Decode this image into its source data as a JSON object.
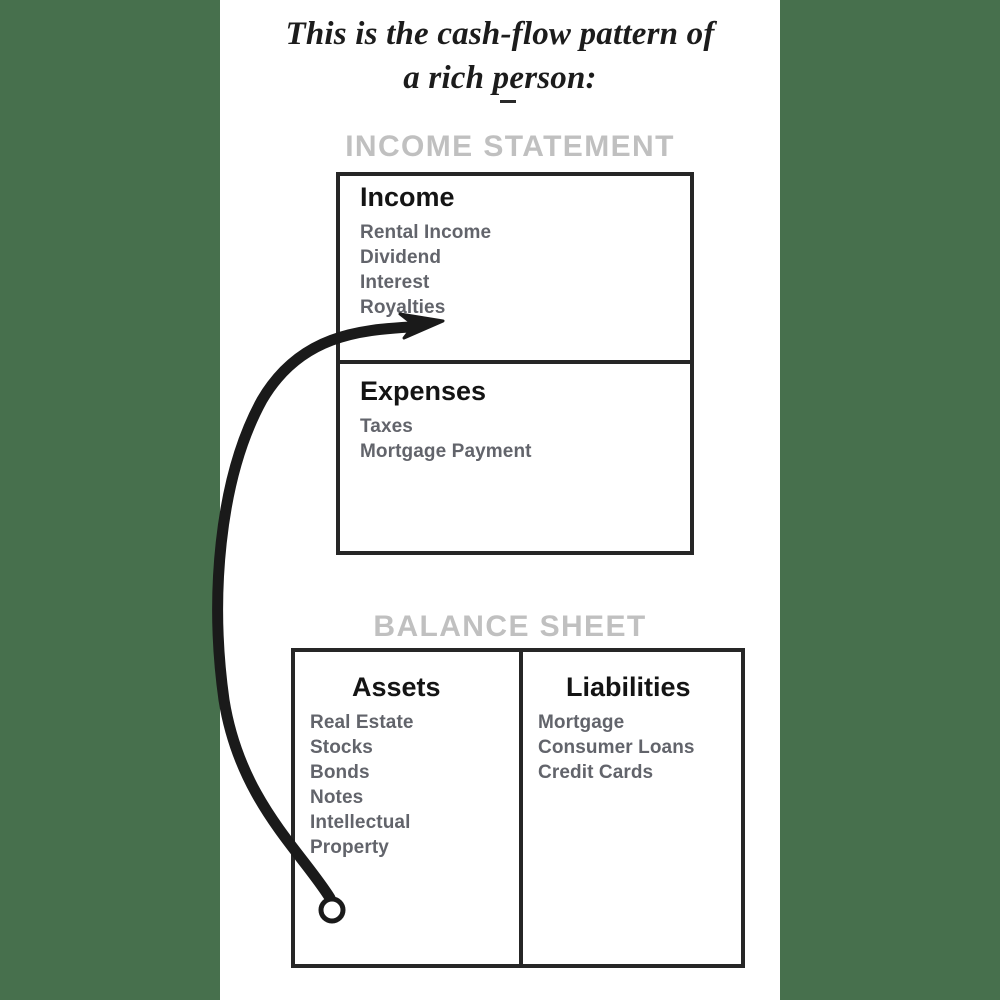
{
  "page": {
    "background_color": "#47704d",
    "sheet_color": "#ffffff"
  },
  "title": {
    "line1": "This is the cash-flow pattern of",
    "line2": "a rich person:",
    "dash": "–"
  },
  "sections": {
    "income_statement": {
      "header": "INCOME STATEMENT",
      "blocks": [
        {
          "title": "Income",
          "items": [
            "Rental Income",
            "Dividend",
            "Interest",
            "Royalties"
          ]
        },
        {
          "title": "Expenses",
          "items": [
            "Taxes",
            "Mortgage Payment"
          ]
        }
      ]
    },
    "balance_sheet": {
      "header": "BALANCE SHEET",
      "blocks": [
        {
          "title": "Assets",
          "items": [
            "Real Estate",
            "Stocks",
            "Bonds",
            "Notes",
            "Intellectual",
            "Property"
          ]
        },
        {
          "title": "Liabilities",
          "items": [
            "Mortgage",
            "Consumer Loans",
            "Credit Cards"
          ]
        }
      ]
    }
  },
  "arrow": {
    "name": "cash-flow-arrow",
    "description": "Curved arrow from Assets up to Income",
    "origin_marker": "circle",
    "color": "#1a1a1a"
  },
  "colors": {
    "ink": "#1c1c1c",
    "box_border": "#262626",
    "section_header": "#c0c0c0",
    "item_text": "#62646b",
    "background_green": "#47704d"
  }
}
